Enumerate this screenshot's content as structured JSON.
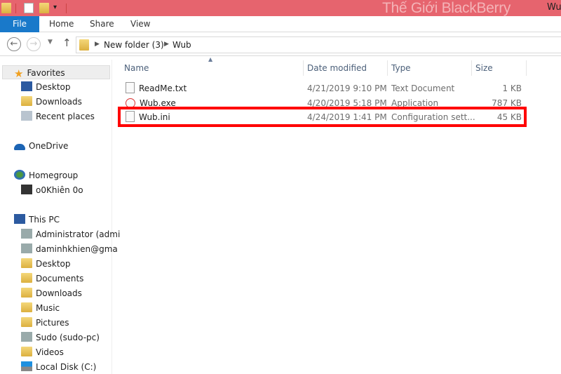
{
  "window": {
    "title_partial": "Wu",
    "watermark": "Thế Giới BlackBerry",
    "titlebar_color": "#e6646e"
  },
  "ribbon": {
    "tabs": [
      {
        "label": "File",
        "active": true
      },
      {
        "label": "Home"
      },
      {
        "label": "Share"
      },
      {
        "label": "View"
      }
    ],
    "file_color": "#1979ca"
  },
  "address": {
    "crumbs": [
      "New folder (3)",
      "Wub"
    ]
  },
  "nav": {
    "favorites": {
      "label": "Favorites",
      "items": [
        "Desktop",
        "Downloads",
        "Recent places"
      ]
    },
    "onedrive": "OneDrive",
    "homegroup": {
      "label": "Homegroup",
      "items": [
        "o0Khiên 0o"
      ]
    },
    "thispc": {
      "label": "This PC",
      "items": [
        "Administrator (admi",
        "daminhkhien@gma",
        "Desktop",
        "Documents",
        "Downloads",
        "Music",
        "Pictures",
        "Sudo (sudo-pc)",
        "Videos",
        "Local Disk (C:)"
      ]
    }
  },
  "columns": [
    "Name",
    "Date modified",
    "Type",
    "Size"
  ],
  "files": [
    {
      "name": "ReadMe.txt",
      "date": "4/21/2019 9:10 PM",
      "type": "Text Document",
      "size": "1 KB"
    },
    {
      "name": "Wub.exe",
      "date": "4/20/2019 5:18 PM",
      "type": "Application",
      "size": "787 KB"
    },
    {
      "name": "Wub.ini",
      "date": "4/24/2019 1:41 PM",
      "type": "Configuration sett...",
      "size": "45 KB",
      "highlighted": true
    }
  ],
  "highlight_color": "#ff0000"
}
